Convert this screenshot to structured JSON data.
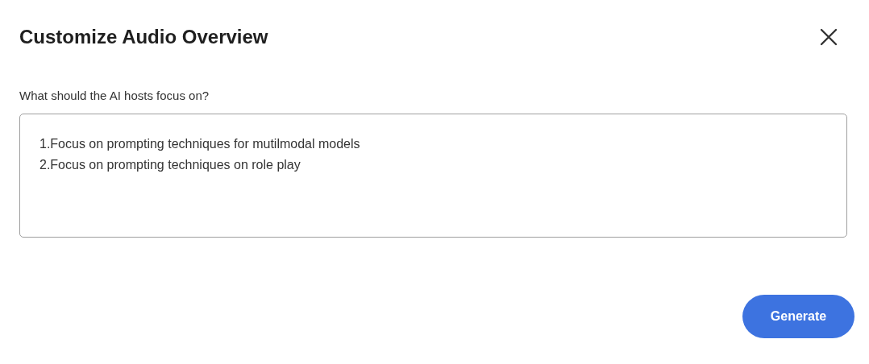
{
  "dialog": {
    "title": "Customize Audio Overview"
  },
  "focus_field": {
    "label": "What should the AI hosts focus on?",
    "value": "1.Focus on prompting techniques for mutilmodal models\n2.Focus on prompting techniques on role play"
  },
  "generate_button": {
    "label": "Generate"
  }
}
